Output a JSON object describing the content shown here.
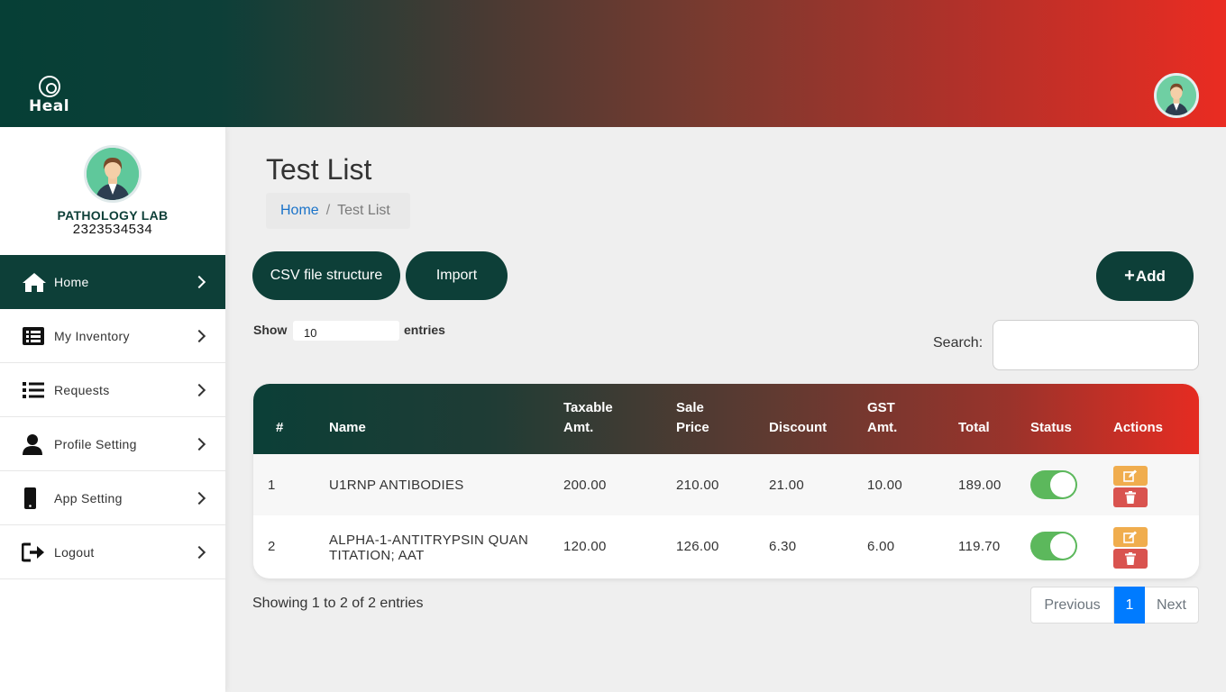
{
  "brand": {
    "logo_text": "Heal"
  },
  "profile": {
    "name": "PATHOLOGY LAB",
    "phone": "2323534534"
  },
  "nav": {
    "items": [
      {
        "label": "Home",
        "icon": "home-icon",
        "active": true
      },
      {
        "label": "My Inventory",
        "icon": "inventory-list-icon"
      },
      {
        "label": "Requests",
        "icon": "list-icon"
      },
      {
        "label": "Profile Setting",
        "icon": "user-icon"
      },
      {
        "label": "App Setting",
        "icon": "mobile-icon"
      },
      {
        "label": "Logout",
        "icon": "logout-icon"
      }
    ]
  },
  "page": {
    "title": "Test List",
    "breadcrumb": {
      "home": "Home",
      "separator": "/",
      "current": "Test List"
    }
  },
  "toolbar": {
    "csv_label": "CSV file structure",
    "import_label": "Import",
    "add_label": "Add"
  },
  "table_controls": {
    "show_label": "Show",
    "entries_value": "10",
    "entries_label": "entries",
    "search_label": "Search:",
    "search_value": ""
  },
  "table": {
    "headers": {
      "num": "#",
      "name": "Name",
      "taxable_1": "Taxable",
      "taxable_2": "Amt.",
      "sale_1": "Sale",
      "sale_2": "Price",
      "discount": "Discount",
      "gst_1": "GST",
      "gst_2": "Amt.",
      "total": "Total",
      "status": "Status",
      "actions": "Actions"
    },
    "rows": [
      {
        "num": "1",
        "name_1": "U1RNP ANTIBODIES",
        "name_2": "",
        "taxable": "200.00",
        "sale": "210.00",
        "discount": "21.00",
        "gst": "10.00",
        "total": "189.00",
        "status": true
      },
      {
        "num": "2",
        "name_1": "ALPHA-1-ANTITRYPSIN QUAN",
        "name_2": "TITATION; AAT",
        "taxable": "120.00",
        "sale": "126.00",
        "discount": "6.30",
        "gst": "6.00",
        "total": "119.70",
        "status": true
      }
    ]
  },
  "footer": {
    "showing": "Showing 1 to 2 of 2 entries",
    "prev": "Previous",
    "current_page": "1",
    "next": "Next"
  },
  "colors": {
    "primary": "#0d3f38",
    "accent_red": "#ea2c22",
    "toggle_on": "#5cb85c",
    "edit": "#f0ad4e",
    "delete": "#d9534f",
    "page_active": "#007bff"
  }
}
